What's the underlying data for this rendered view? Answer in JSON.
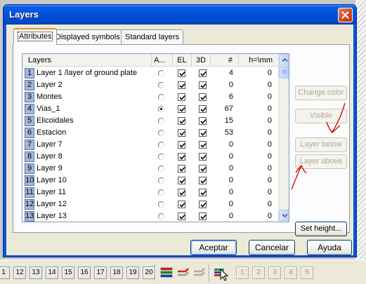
{
  "window": {
    "title": "Layers",
    "close_icon": "close-icon"
  },
  "tabs": [
    {
      "label": "Attributes",
      "active": true
    },
    {
      "label": "Displayed symbols",
      "active": false
    },
    {
      "label": "Standard layers",
      "active": false
    }
  ],
  "columns": [
    "Layers",
    "A...",
    "EL",
    "3D",
    "#",
    "h=\\mm"
  ],
  "layers": [
    {
      "num": "1",
      "name": "Layer 1 /layer of ground plate",
      "active": false,
      "el": true,
      "d3": true,
      "count": "4",
      "h": "0"
    },
    {
      "num": "2",
      "name": "Layer 2",
      "active": false,
      "el": true,
      "d3": true,
      "count": "0",
      "h": "0"
    },
    {
      "num": "3",
      "name": "Montes",
      "active": false,
      "el": true,
      "d3": true,
      "count": "6",
      "h": "0"
    },
    {
      "num": "4",
      "name": "Vias_1",
      "active": true,
      "el": true,
      "d3": true,
      "count": "67",
      "h": "0"
    },
    {
      "num": "5",
      "name": "Elicoidales",
      "active": false,
      "el": true,
      "d3": true,
      "count": "15",
      "h": "0"
    },
    {
      "num": "6",
      "name": "Estacion",
      "active": false,
      "el": true,
      "d3": true,
      "count": "53",
      "h": "0"
    },
    {
      "num": "7",
      "name": "Layer 7",
      "active": false,
      "el": true,
      "d3": true,
      "count": "0",
      "h": "0"
    },
    {
      "num": "8",
      "name": "Layer 8",
      "active": false,
      "el": true,
      "d3": true,
      "count": "0",
      "h": "0"
    },
    {
      "num": "9",
      "name": "Layer 9",
      "active": false,
      "el": true,
      "d3": true,
      "count": "0",
      "h": "0"
    },
    {
      "num": "10",
      "name": "Layer 10",
      "active": false,
      "el": true,
      "d3": true,
      "count": "0",
      "h": "0"
    },
    {
      "num": "11",
      "name": "Layer 11",
      "active": false,
      "el": true,
      "d3": true,
      "count": "0",
      "h": "0"
    },
    {
      "num": "12",
      "name": "Layer 12",
      "active": false,
      "el": true,
      "d3": true,
      "count": "0",
      "h": "0"
    },
    {
      "num": "13",
      "name": "Layer 13",
      "active": false,
      "el": true,
      "d3": true,
      "count": "0",
      "h": "0"
    }
  ],
  "side_buttons": {
    "change_color": "Change color",
    "visible": "Visible",
    "layer_below": "Layer below",
    "layer_above": "Layer above",
    "set_height": "Set height..."
  },
  "footer": {
    "ok": "Aceptar",
    "cancel": "Cancelar",
    "help": "Ayuda"
  },
  "bottom_toolbar": {
    "layer_buttons": [
      "1",
      "12",
      "13",
      "14",
      "15",
      "16",
      "17",
      "18",
      "19",
      "20"
    ],
    "dim_buttons": [
      "1",
      "2",
      "3",
      "4",
      "5"
    ]
  },
  "colors": {
    "title_bar": "#0351d9",
    "annotation": "#d40000",
    "active_tab_accent": "#e68b2c"
  }
}
